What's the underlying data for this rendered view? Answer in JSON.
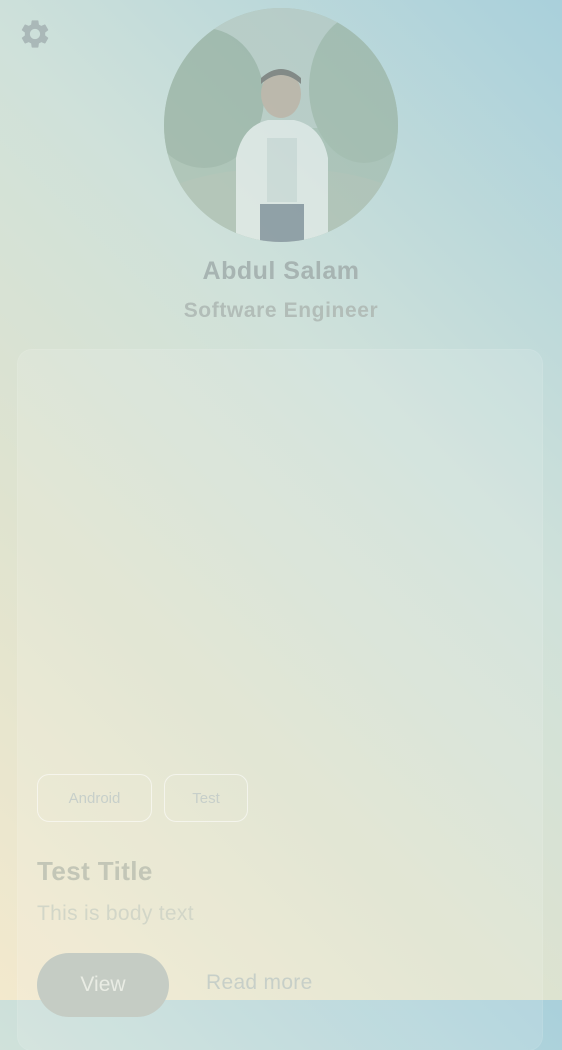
{
  "header": {
    "settings_icon": "gear-icon"
  },
  "profile": {
    "avatar_icon": "profile-photo",
    "name": "Abdul Salam",
    "role": "Software Engineer"
  },
  "card": {
    "tags": [
      {
        "label": "Android"
      },
      {
        "label": "Test"
      }
    ],
    "title": "Test Title",
    "body": "This is body text",
    "actions": {
      "view_label": "View",
      "read_more_label": "Read more"
    }
  },
  "colors": {
    "background_start": "#f3e9cd",
    "background_end": "#a9d0db",
    "gear": "#aab8b8",
    "text_muted": "#a7b4b2"
  }
}
